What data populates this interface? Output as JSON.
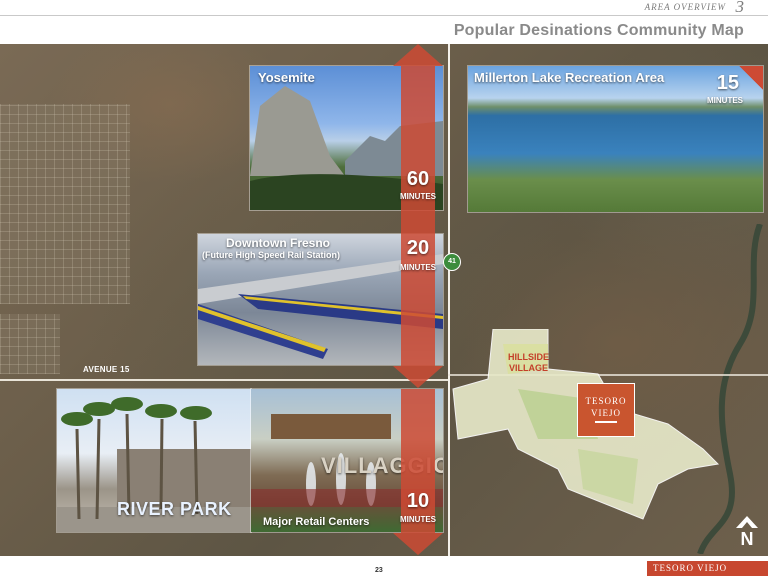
{
  "header": {
    "section_label": "AREA OVERVIEW",
    "section_number": "3",
    "page_title": "Popular Desinations Community Map"
  },
  "map": {
    "road_label": "AVENUE 15",
    "highway_shield": "41",
    "north_label": "N",
    "development": {
      "logo_line1": "TESORO",
      "logo_line2": "VIEJO",
      "village_label_line1": "HILLSIDE",
      "village_label_line2": "VILLAGE"
    }
  },
  "destinations": [
    {
      "name": "Yosemite",
      "time": "60",
      "unit": "MINUTES",
      "photo": "yosemite-valley-photo"
    },
    {
      "name": "Millerton Lake Recreation Area",
      "time": "15",
      "unit": "MINUTES",
      "photo": "millerton-lake-photo"
    },
    {
      "name": "Downtown Fresno",
      "subtitle": "(Future High Speed Rail Station)",
      "time": "20",
      "unit": "MINUTES",
      "photo": "high-speed-rail-photo"
    },
    {
      "name": "Major Retail Centers",
      "time": "10",
      "unit": "MINUTES",
      "photos": [
        "river-park-photo",
        "villaggio-photo"
      ]
    }
  ],
  "retail_signs": {
    "river_park": "RIVER PARK",
    "villaggio": "VILLAGGIO"
  },
  "footer": {
    "page_number": "23",
    "brand": "TESORO VIEJO"
  },
  "colors": {
    "accent_red": "#cd4a34",
    "title_gray": "#8a8a8a",
    "brand_red": "#c7472f"
  }
}
